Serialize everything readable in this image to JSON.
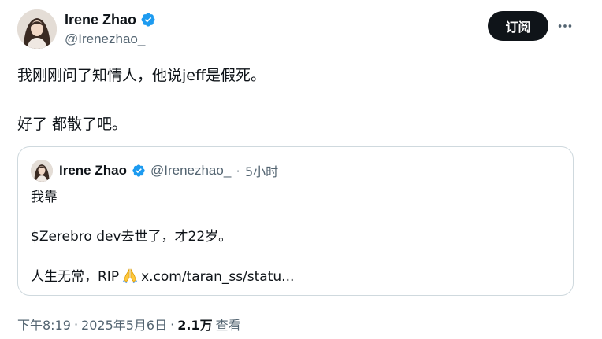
{
  "author": {
    "display_name": "Irene Zhao",
    "handle": "@Irenezhao_",
    "verified": true,
    "verified_color": "#1d9bf0"
  },
  "actions": {
    "subscribe_label": "订阅",
    "more_icon": "more-horizontal-icon"
  },
  "tweet": {
    "lines": [
      "我刚刚问了知情人，他说jeff是假死。",
      "好了 都散了吧。"
    ]
  },
  "quoted_tweet": {
    "display_name": "Irene Zhao",
    "handle": "@Irenezhao_",
    "separator": "·",
    "time": "5小时",
    "lines": [
      "我靠",
      "$Zerebro dev去世了，才22岁。",
      "人生无常，RIP",
      "x.com/taran_ss/statu..."
    ],
    "emoji_icon": "folded-hands-icon"
  },
  "meta": {
    "time": "下午8:19",
    "separator": "·",
    "date": "2025年5月6日",
    "separator2": "·",
    "views_count": "2.1万",
    "views_label": "查看"
  },
  "colors": {
    "text": "#0f1419",
    "secondary": "#536471",
    "border": "#cfd9de",
    "accent": "#1d9bf0"
  }
}
